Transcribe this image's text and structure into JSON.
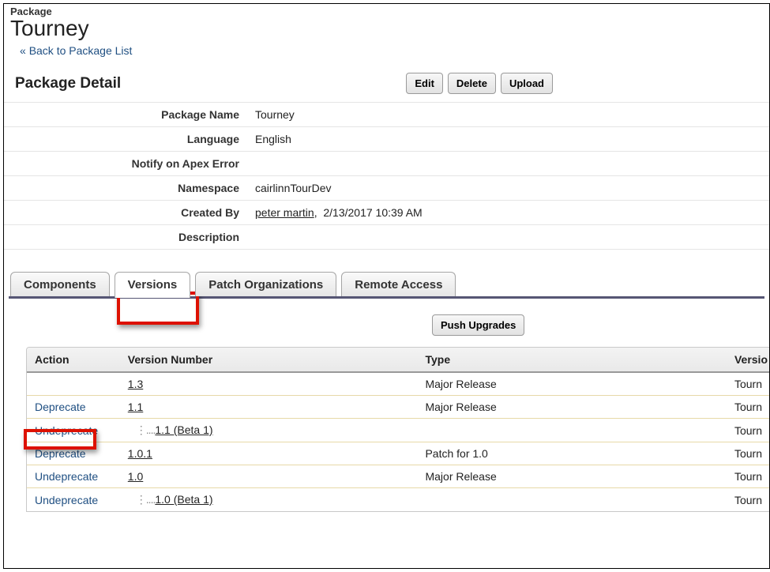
{
  "header": {
    "label": "Package",
    "title": "Tourney",
    "back_chevron": "«",
    "back_label": "Back to Package List"
  },
  "detail": {
    "section_title": "Package Detail",
    "buttons": {
      "edit": "Edit",
      "delete": "Delete",
      "upload": "Upload"
    },
    "fields": {
      "package_name_label": "Package Name",
      "package_name": "Tourney",
      "language_label": "Language",
      "language": "English",
      "notify_label": "Notify on Apex Error",
      "notify": "",
      "namespace_label": "Namespace",
      "namespace": "cairlinnTourDev",
      "created_by_label": "Created By",
      "created_by_user": "peter martin",
      "created_by_sep": ",",
      "created_by_date": "2/13/2017 10:39 AM",
      "description_label": "Description",
      "description": ""
    }
  },
  "tabs": {
    "components": "Components",
    "versions": "Versions",
    "patch_orgs": "Patch Organizations",
    "remote_access": "Remote Access"
  },
  "panel": {
    "push_upgrades": "Push Upgrades",
    "columns": {
      "action": "Action",
      "version_number": "Version Number",
      "type": "Type",
      "version_name": "Versio"
    },
    "rows": [
      {
        "action": "",
        "version": "1.3",
        "indent": false,
        "type": "Major Release",
        "name": "Tourn"
      },
      {
        "action": "Deprecate",
        "version": "1.1",
        "indent": false,
        "type": "Major Release",
        "name": "Tourn"
      },
      {
        "action": "Undeprecate",
        "version": "1.1 (Beta 1)",
        "indent": true,
        "type": "",
        "name": "Tourn"
      },
      {
        "action": "Deprecate",
        "version": "1.0.1",
        "indent": false,
        "type": "Patch for 1.0",
        "name": "Tourn"
      },
      {
        "action": "Undeprecate",
        "version": "1.0",
        "indent": false,
        "type": "Major Release",
        "name": "Tourn"
      },
      {
        "action": "Undeprecate",
        "version": "1.0 (Beta 1)",
        "indent": true,
        "type": "",
        "name": "Tourn"
      }
    ]
  }
}
